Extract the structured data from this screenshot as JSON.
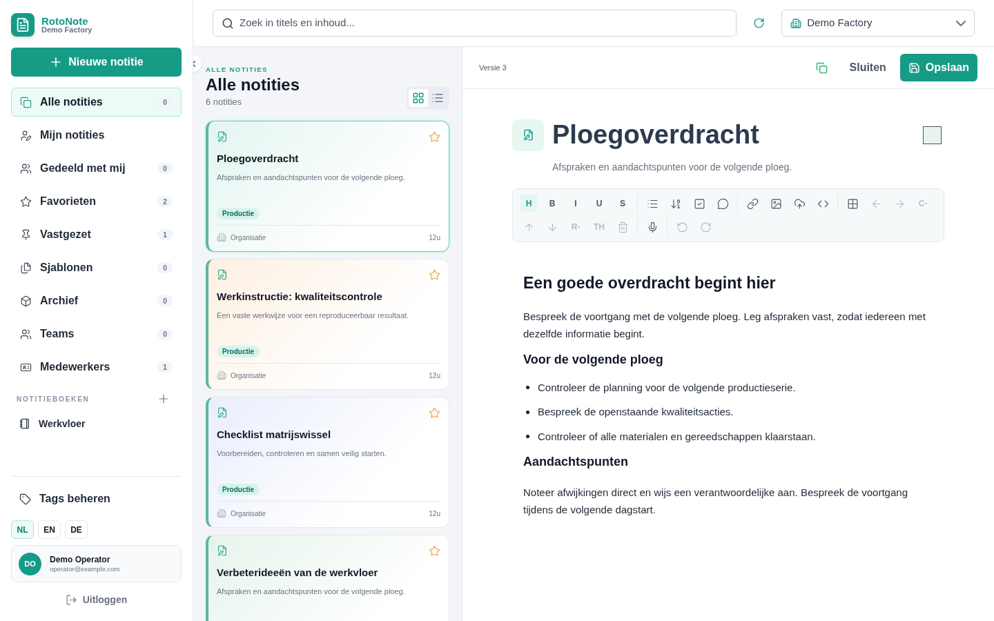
{
  "brand": {
    "name": "RotoNote",
    "subtitle": "Demo Factory"
  },
  "new_note_button": "Nieuwe notitie",
  "nav": [
    {
      "kind": "all",
      "label": "Alle notities",
      "count": "0",
      "selected": true
    },
    {
      "kind": "mine",
      "label": "Mijn notities",
      "selected": false
    },
    {
      "kind": "shared",
      "label": "Gedeeld met mij",
      "count": "0",
      "selected": false
    },
    {
      "kind": "favorites",
      "label": "Favorieten",
      "count": "2",
      "selected": false
    },
    {
      "kind": "pinned",
      "label": "Vastgezet",
      "count": "1",
      "selected": false
    },
    {
      "kind": "templates",
      "label": "Sjablonen",
      "count": "0",
      "selected": false
    },
    {
      "kind": "archive",
      "label": "Archief",
      "count": "0",
      "selected": false
    },
    {
      "kind": "teams",
      "label": "Teams",
      "count": "0",
      "selected": false
    },
    {
      "kind": "employees",
      "label": "Medewerkers",
      "count": "1",
      "selected": false
    }
  ],
  "notebooks": {
    "title": "NOTITIEBOEKEN",
    "items": [
      "Werkvloer"
    ]
  },
  "manage_tags": "Tags beheren",
  "languages": [
    {
      "label": "NL",
      "selected": true
    },
    {
      "label": "EN",
      "selected": false
    },
    {
      "label": "DE",
      "selected": false
    }
  ],
  "user": {
    "initials": "DO",
    "name": "Demo Operator",
    "email": "operator@example.com"
  },
  "logout": "Uitloggen",
  "search": {
    "placeholder": "Zoek in titels en inhoud..."
  },
  "workspace_select": {
    "value": "Demo Factory"
  },
  "list": {
    "eyebrow": "ALLE NOTITIES",
    "title": "Alle notities",
    "count": "6 notities",
    "view_modes": [
      {
        "kind": "grid",
        "selected": true
      },
      {
        "kind": "list",
        "selected": false
      }
    ],
    "notes": [
      {
        "title": "Ploegoverdracht",
        "summary": "Afspraken en aandachtspunten voor de volgende ploeg.",
        "tag": "Productie",
        "scope": "Organisatie",
        "age": "12u",
        "color": "#e3f5f0",
        "selected": true
      },
      {
        "title": "Werkinstructie: kwaliteitscontrole",
        "summary": "Een vaste werkwijze voor een reproduceerbaar resultaat.",
        "tag": "Productie",
        "scope": "Organisatie",
        "age": "12u",
        "color": "#fdf0e1",
        "selected": false
      },
      {
        "title": "Checklist matrijswissel",
        "summary": "Voorbereiden, controleren en samen veilig starten.",
        "tag": "Productie",
        "scope": "Organisatie",
        "age": "12u",
        "color": "#eaeefc",
        "selected": false
      },
      {
        "title": "Verbeterideeën van de werkvloer",
        "summary": "Afspraken en aandachtspunten voor de volgende ploeg.",
        "color": "#e6f4ec",
        "selected": false
      }
    ]
  },
  "editor": {
    "version": "Versie 3",
    "close": "Sluiten",
    "save": "Opslaan",
    "title": "Ploegoverdracht",
    "subtitle": "Afspraken en aandachtspunten voor de volgende ploeg.",
    "toolbar": [
      [
        [
          {
            "kind": "text",
            "label": "H",
            "active": true,
            "disabled": false
          },
          {
            "kind": "text",
            "label": "B",
            "active": false,
            "disabled": false
          },
          {
            "kind": "text",
            "label": "I",
            "active": false,
            "disabled": false
          },
          {
            "kind": "text",
            "label": "U",
            "active": false,
            "disabled": false
          },
          {
            "kind": "text",
            "label": "S",
            "active": false,
            "disabled": false
          }
        ],
        [
          {
            "kind": "bullets",
            "active": false,
            "disabled": false
          },
          {
            "kind": "numbers",
            "active": false,
            "disabled": false
          },
          {
            "kind": "checkbox",
            "active": false,
            "disabled": false
          },
          {
            "kind": "comment",
            "active": false,
            "disabled": false
          }
        ],
        [
          {
            "kind": "link",
            "active": false,
            "disabled": false
          },
          {
            "kind": "image",
            "active": false,
            "disabled": false
          },
          {
            "kind": "upload",
            "active": false,
            "disabled": false
          },
          {
            "kind": "code",
            "active": false,
            "disabled": false
          }
        ],
        [
          {
            "kind": "table",
            "active": false,
            "disabled": false
          },
          {
            "kind": "left",
            "active": false,
            "disabled": true
          },
          {
            "kind": "right",
            "active": false,
            "disabled": true
          },
          {
            "kind": "text",
            "label": "C-",
            "active": false,
            "disabled": true
          }
        ]
      ],
      [
        [
          {
            "kind": "up",
            "active": false,
            "disabled": true
          },
          {
            "kind": "down",
            "active": false,
            "disabled": true
          },
          {
            "kind": "text",
            "label": "R-",
            "active": false,
            "disabled": true
          },
          {
            "kind": "text",
            "label": "TH",
            "active": false,
            "disabled": true
          },
          {
            "kind": "trash",
            "active": false,
            "disabled": true
          }
        ],
        [
          {
            "kind": "mic",
            "active": false,
            "disabled": false
          }
        ],
        [
          {
            "kind": "undo",
            "active": false,
            "disabled": true
          },
          {
            "kind": "redo",
            "active": false,
            "disabled": true
          }
        ]
      ]
    ],
    "content": [
      {
        "kind": "h2",
        "text": "Een goede overdracht begint hier"
      },
      {
        "kind": "p",
        "text": "Bespreek de voortgang met de volgende ploeg. Leg afspraken vast, zodat iedereen met dezelfde informatie begint."
      },
      {
        "kind": "h3",
        "text": "Voor de volgende ploeg"
      },
      {
        "kind": "ul",
        "items": [
          "Controleer de planning voor de volgende productieserie.",
          "Bespreek de openstaande kwaliteitsacties.",
          "Controleer of alle materialen en gereedschappen klaarstaan."
        ]
      },
      {
        "kind": "h3",
        "text": "Aandachtspunten"
      },
      {
        "kind": "p",
        "text": "Noteer afwijkingen direct en wijs een verantwoordelijke aan. Bespreek de voortgang tijdens de volgende dagstart."
      }
    ]
  }
}
